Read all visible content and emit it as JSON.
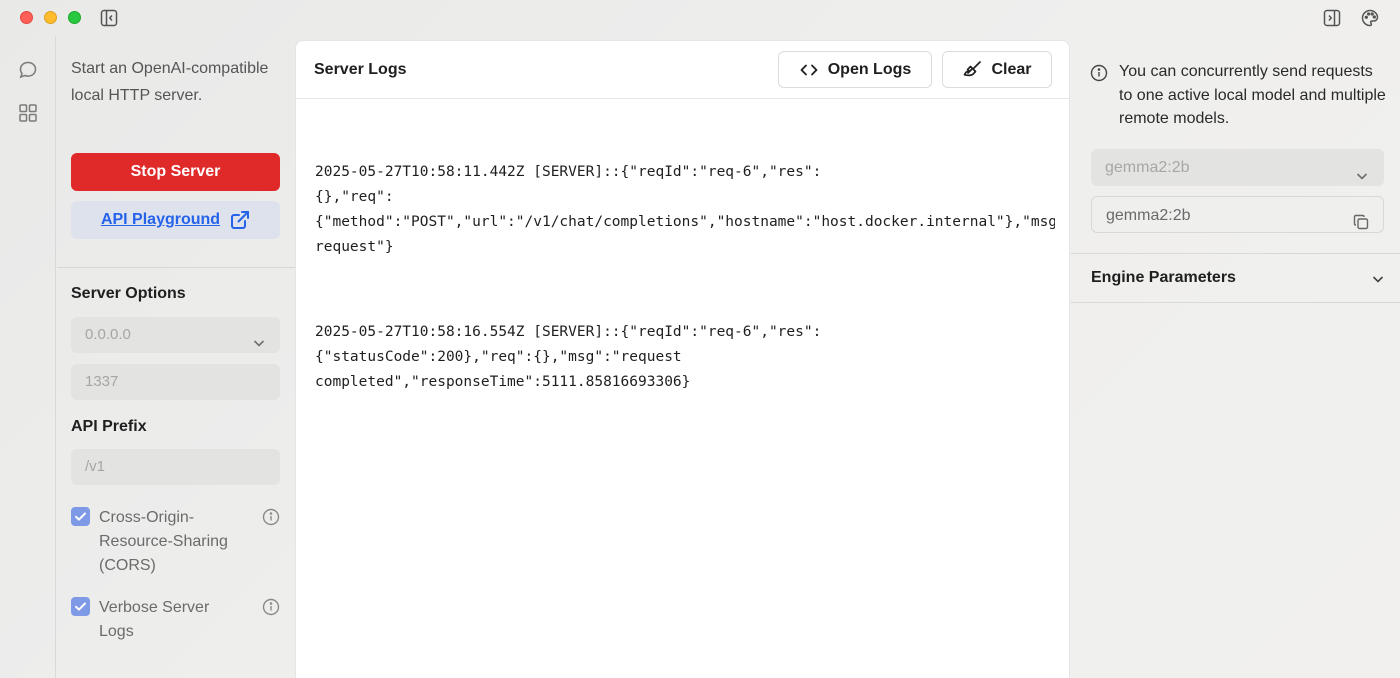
{
  "window": {
    "icons": [
      "sidebar-toggle-icon",
      "right-panel-toggle-icon",
      "palette-icon"
    ]
  },
  "rail": {
    "items": [
      {
        "name": "chat",
        "icon": "chat-bubble-icon"
      },
      {
        "name": "hub",
        "icon": "grid-icon"
      }
    ]
  },
  "left_panel": {
    "description": "Start an OpenAI-compatible local HTTP server.",
    "stop_button": "Stop Server",
    "playground_button": "API Playground",
    "server_options_heading": "Server Options",
    "host": {
      "value": "0.0.0.0"
    },
    "port": {
      "value": "1337"
    },
    "api_prefix_heading": "API Prefix",
    "api_prefix": {
      "value": "/v1"
    },
    "cors": {
      "label": "Cross-Origin-Resource-Sharing (CORS)",
      "checked": true
    },
    "verbose": {
      "label": "Verbose Server Logs",
      "checked": true
    }
  },
  "logs": {
    "title": "Server Logs",
    "open_logs_button": "Open Logs",
    "clear_button": "Clear",
    "entries": [
      "2025-05-27T10:58:11.442Z [SERVER]::{\"reqId\":\"req-6\",\"res\":\n{},\"req\":\n{\"method\":\"POST\",\"url\":\"/v1/chat/completions\",\"hostname\":\"host.docker.internal\"},\"msg\":\"incoming\nrequest\"}",
      "2025-05-27T10:58:16.554Z [SERVER]::{\"reqId\":\"req-6\",\"res\":\n{\"statusCode\":200},\"req\":{},\"msg\":\"request\ncompleted\",\"responseTime\":5111.85816693306}"
    ]
  },
  "right_panel": {
    "info": "You can concurrently send requests to one active local model and multiple remote models.",
    "model_select": "gemma2:2b",
    "model_id": "gemma2:2b",
    "engine_parameters": "Engine Parameters"
  },
  "colors": {
    "stop_red": "#e02a2a",
    "link_blue": "#2563eb",
    "checkbox_blue": "#7e9ae6"
  }
}
